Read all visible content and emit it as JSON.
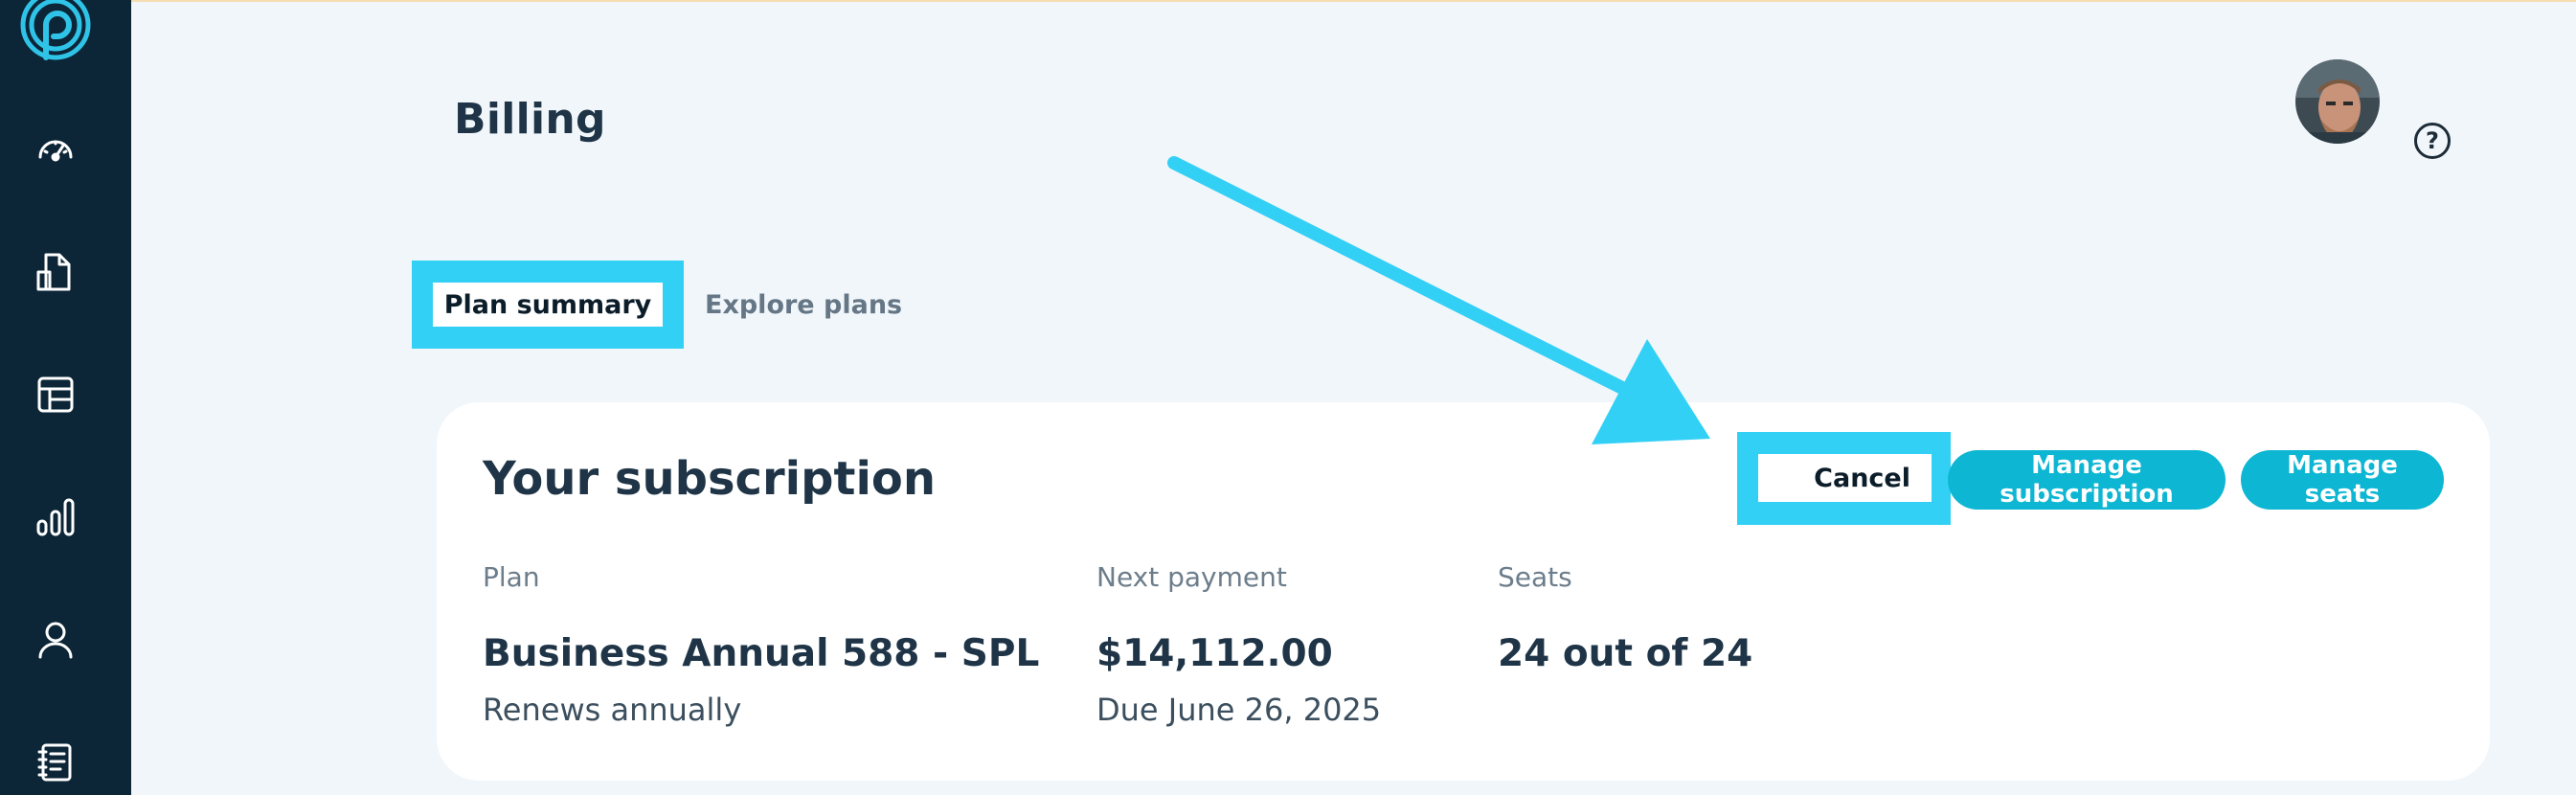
{
  "page": {
    "title": "Billing"
  },
  "tabs": [
    {
      "label": "Plan summary",
      "active": true
    },
    {
      "label": "Explore plans",
      "active": false
    }
  ],
  "subscription": {
    "title": "Your subscription",
    "buttons": {
      "cancel": "Cancel",
      "manage_subscription": "Manage subscription",
      "manage_seats": "Manage seats"
    },
    "plan": {
      "label": "Plan",
      "value": "Business Annual 588 - SPL",
      "sub": "Renews annually"
    },
    "next_payment": {
      "label": "Next payment",
      "value": "$14,112.00",
      "sub": "Due June 26, 2025"
    },
    "seats": {
      "label": "Seats",
      "value": "24 out of 24"
    }
  },
  "header": {
    "help_glyph": "?"
  },
  "sidebar": {
    "icons": [
      "logo-icon",
      "dashboard-gauge-icon",
      "documents-icon",
      "table-layout-icon",
      "analytics-bars-icon",
      "user-icon",
      "notebook-icon"
    ]
  },
  "colors": {
    "sidebar_bg": "#0c2638",
    "page_bg": "#f1f6fa",
    "accent": "#0db6d2",
    "annotation_highlight": "#33d0f5",
    "text_dark": "#1f3547"
  }
}
